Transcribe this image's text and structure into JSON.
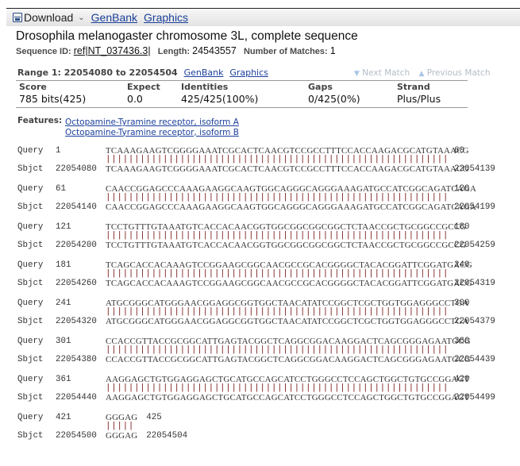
{
  "toolbar": {
    "download_label": "Download",
    "download_icon": "floppy-disk-icon",
    "dropdown_icon": "chevron-down-icon",
    "links": [
      "GenBank",
      "Graphics"
    ]
  },
  "title": "Drosophila melanogaster chromosome 3L, complete sequence",
  "seqinfo": {
    "id_label": "Sequence ID:",
    "id_value": "ref|NT_037436.3|",
    "length_label": "Length:",
    "length_value": "24543557",
    "matches_label": "Number of Matches:",
    "matches_value": "1"
  },
  "range": {
    "label": "Range 1: 22054080 to 22054504",
    "links": [
      "GenBank",
      "Graphics"
    ]
  },
  "nav": {
    "next": "Next Match",
    "previous": "Previous Match"
  },
  "stats": {
    "headers": [
      "Score",
      "Expect",
      "Identities",
      "Gaps",
      "Strand"
    ],
    "values": [
      "785 bits(425)",
      "0.0",
      "425/425(100%)",
      "0/425(0%)",
      "Plus/Plus"
    ]
  },
  "features": {
    "label": "Features:",
    "items": [
      "Octopamine-Tyramine receptor, isoform A",
      "Octopamine-Tyramine receptor, isoform B"
    ]
  },
  "alignment": {
    "query_label": "Query",
    "sbjct_label": "Sbjct",
    "blocks": [
      {
        "q_start": "1",
        "q_end": "60",
        "s_start": "22054080",
        "s_end": "22054139",
        "seq": "TCAAAGAAGTCGGGGAAATCGCACTCAACGTCCGCCTTTCCACCAAGACGCATGTAAACG"
      },
      {
        "q_start": "61",
        "q_end": "120",
        "s_start": "22054140",
        "s_end": "22054199",
        "seq": "CAACCGGAGCCCAAAGAAGGCAAGTGGCAGGGCAGGGAAAGATGCCATCGGCAGATCAGA"
      },
      {
        "q_start": "121",
        "q_end": "180",
        "s_start": "22054200",
        "s_end": "22054259",
        "seq": "TCCTGTTTGTAAATGTCACCACAACGGTGGCGGCGGCGGCTCTAACCGCTGCGGCCGCCG"
      },
      {
        "q_start": "181",
        "q_end": "240",
        "s_start": "22054260",
        "s_end": "22054319",
        "seq": "TCAGCACCACAAAGTCCGGAAGCGGCAACGCCGCACGGGGCTACACGGATTCGGATGACG"
      },
      {
        "q_start": "241",
        "q_end": "300",
        "s_start": "22054320",
        "s_end": "22054379",
        "seq": "ATGCGGGCATGGGAACGGAGGCGGTGGCTAACATATCCGGCTCGCTGGTGGAGGGCCTGA"
      },
      {
        "q_start": "301",
        "q_end": "360",
        "s_start": "22054380",
        "s_end": "22054439",
        "seq": "CCACCGTTACCGCGGCATTGAGTACGGCTCAGGCGGACAAGGACTCAGCGGGAGAATGCG"
      },
      {
        "q_start": "361",
        "q_end": "420",
        "s_start": "22054440",
        "s_end": "22054499",
        "seq": "AAGGAGCTGTGGAGGAGCTGCATGCCAGCATCCTGGGCCTCCAGCTGGCTGTGCCGGAGT"
      },
      {
        "q_start": "421",
        "q_end": "425",
        "s_start": "22054500",
        "s_end": "22054504",
        "seq": "GGGAG"
      }
    ]
  }
}
